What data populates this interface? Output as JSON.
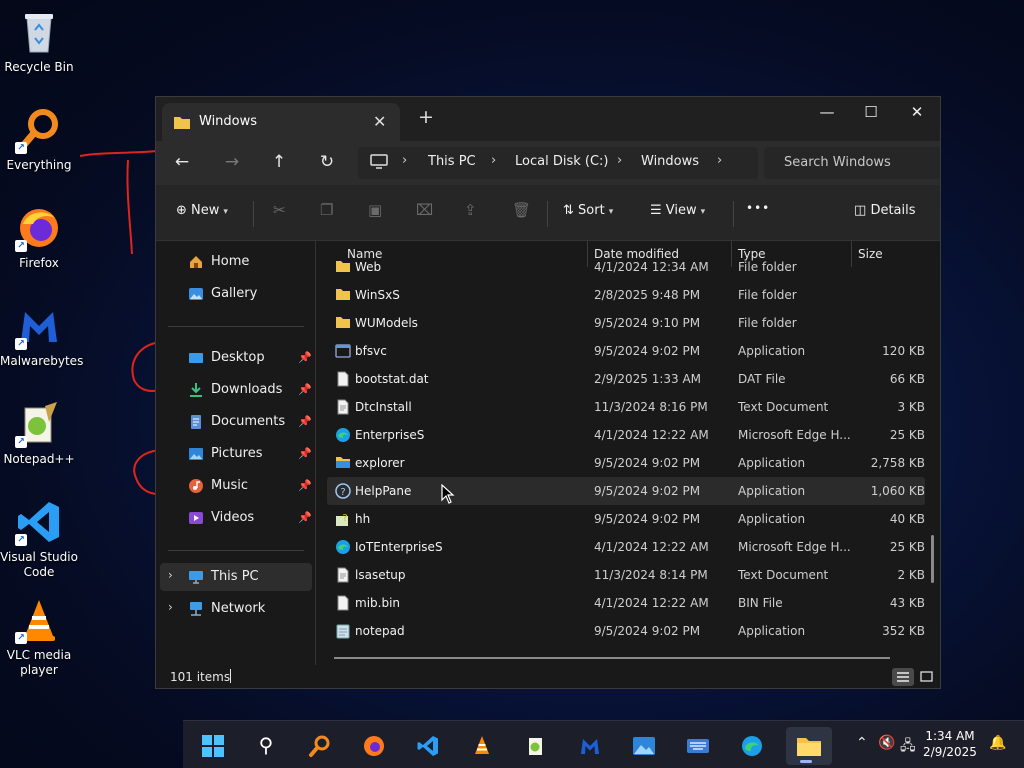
{
  "desktop": {
    "icons": [
      {
        "label": "Recycle Bin",
        "icon": "recycle-bin-icon"
      },
      {
        "label": "Everything",
        "icon": "everything-search-icon"
      },
      {
        "label": "Firefox",
        "icon": "firefox-icon"
      },
      {
        "label": "Malwarebytes",
        "icon": "malwarebytes-icon"
      },
      {
        "label": "Notepad++",
        "icon": "notepad-plus-plus-icon"
      },
      {
        "label": "Visual Studio Code",
        "icon": "vscode-icon"
      },
      {
        "label": "VLC media player",
        "icon": "vlc-icon"
      }
    ],
    "scribble_color": "#e0241c"
  },
  "window": {
    "tab_title": "Windows",
    "new_tab": "+",
    "controls": {
      "minimize": "—",
      "maximize": "☐",
      "close": "✕"
    },
    "breadcrumb": [
      "This PC",
      "Local Disk (C:)",
      "Windows"
    ],
    "search_placeholder": "Search Windows",
    "toolbar": {
      "new_label": "New",
      "sort_label": "Sort",
      "view_label": "View",
      "more_label": "•••",
      "details_label": "Details"
    },
    "nav": {
      "top": [
        {
          "label": "Home",
          "icon": "home-icon"
        },
        {
          "label": "Gallery",
          "icon": "gallery-icon"
        }
      ],
      "quick_access": [
        {
          "label": "Desktop",
          "icon": "desktop-icon"
        },
        {
          "label": "Downloads",
          "icon": "downloads-icon"
        },
        {
          "label": "Documents",
          "icon": "documents-icon"
        },
        {
          "label": "Pictures",
          "icon": "pictures-icon"
        },
        {
          "label": "Music",
          "icon": "music-icon"
        },
        {
          "label": "Videos",
          "icon": "videos-icon"
        }
      ],
      "bottom": [
        {
          "label": "This PC",
          "icon": "this-pc-icon",
          "selected": true
        },
        {
          "label": "Network",
          "icon": "network-icon",
          "selected": false
        }
      ]
    },
    "columns": {
      "name": "Name",
      "date": "Date modified",
      "type": "Type",
      "size": "Size"
    },
    "files": [
      {
        "name": "Web",
        "date": "4/1/2024 12:34 AM",
        "type": "File folder",
        "size": "",
        "icon": "folder-icon"
      },
      {
        "name": "WinSxS",
        "date": "2/8/2025 9:48 PM",
        "type": "File folder",
        "size": "",
        "icon": "folder-icon"
      },
      {
        "name": "WUModels",
        "date": "9/5/2024 9:10 PM",
        "type": "File folder",
        "size": "",
        "icon": "folder-icon"
      },
      {
        "name": "bfsvc",
        "date": "9/5/2024 9:02 PM",
        "type": "Application",
        "size": "120 KB",
        "icon": "application-icon"
      },
      {
        "name": "bootstat.dat",
        "date": "2/9/2025 1:33 AM",
        "type": "DAT File",
        "size": "66 KB",
        "icon": "file-icon"
      },
      {
        "name": "DtcInstall",
        "date": "11/3/2024 8:16 PM",
        "type": "Text Document",
        "size": "3 KB",
        "icon": "text-file-icon"
      },
      {
        "name": "EnterpriseS",
        "date": "4/1/2024 12:22 AM",
        "type": "Microsoft Edge H...",
        "size": "25 KB",
        "icon": "edge-file-icon"
      },
      {
        "name": "explorer",
        "date": "9/5/2024 9:02 PM",
        "type": "Application",
        "size": "2,758 KB",
        "icon": "explorer-app-icon"
      },
      {
        "name": "HelpPane",
        "date": "9/5/2024 9:02 PM",
        "type": "Application",
        "size": "1,060 KB",
        "icon": "help-icon"
      },
      {
        "name": "hh",
        "date": "9/5/2024 9:02 PM",
        "type": "Application",
        "size": "40 KB",
        "icon": "help-app-icon"
      },
      {
        "name": "IoTEnterpriseS",
        "date": "4/1/2024 12:22 AM",
        "type": "Microsoft Edge H...",
        "size": "25 KB",
        "icon": "edge-file-icon"
      },
      {
        "name": "lsasetup",
        "date": "11/3/2024 8:14 PM",
        "type": "Text Document",
        "size": "2 KB",
        "icon": "text-file-icon"
      },
      {
        "name": "mib.bin",
        "date": "4/1/2024 12:22 AM",
        "type": "BIN File",
        "size": "43 KB",
        "icon": "file-icon"
      },
      {
        "name": "notepad",
        "date": "9/5/2024 9:02 PM",
        "type": "Application",
        "size": "352 KB",
        "icon": "notepad-icon"
      }
    ],
    "status": {
      "item_count": "101 items"
    }
  },
  "taskbar": {
    "apps": [
      {
        "name": "start",
        "icon": "windows-start-icon"
      },
      {
        "name": "search",
        "icon": "search-icon"
      },
      {
        "name": "everything",
        "icon": "everything-search-icon"
      },
      {
        "name": "firefox",
        "icon": "firefox-icon"
      },
      {
        "name": "vscode",
        "icon": "vscode-icon"
      },
      {
        "name": "vlc",
        "icon": "vlc-icon"
      },
      {
        "name": "notepad++",
        "icon": "notepad-plus-plus-icon"
      },
      {
        "name": "malwarebytes",
        "icon": "malwarebytes-icon"
      },
      {
        "name": "photos",
        "icon": "photos-icon"
      },
      {
        "name": "touch-keyboard",
        "icon": "keyboard-icon"
      },
      {
        "name": "edge",
        "icon": "edge-icon"
      },
      {
        "name": "file-explorer",
        "icon": "file-explorer-icon",
        "active": true
      }
    ],
    "clock": {
      "time": "1:34 AM",
      "date": "2/9/2025"
    }
  },
  "colors": {
    "folder": "#f0c44c",
    "accent": "#4c8dff",
    "window_bg": "#191919"
  }
}
